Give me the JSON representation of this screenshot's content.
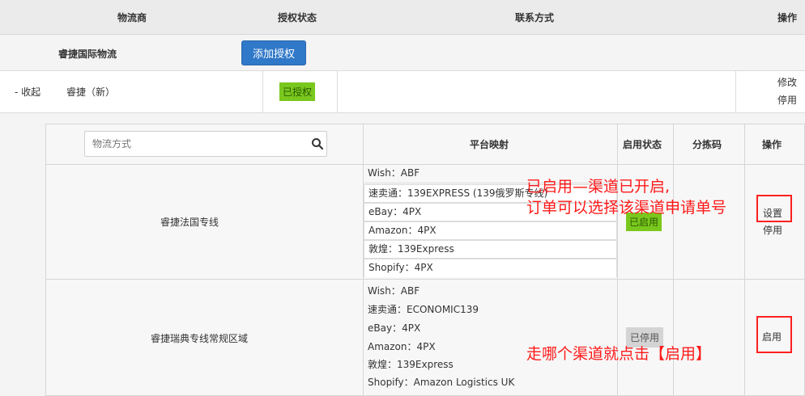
{
  "header": {
    "carrier": "物流商",
    "auth_status": "授权状态",
    "contact": "联系方式",
    "actions": "操作"
  },
  "provider": {
    "name": "睿捷国际物流",
    "add_auth_button": "添加授权"
  },
  "account": {
    "collapse": "- 收起",
    "name": "睿捷（新）",
    "status": "已授权",
    "action_edit": "修改",
    "action_disable": "停用"
  },
  "channels_table": {
    "search_placeholder": "物流方式",
    "columns": {
      "mapping": "平台映射",
      "status": "启用状态",
      "sort_code": "分拣码",
      "actions": "操作"
    },
    "rows": [
      {
        "name": "睿捷法国专线",
        "mappings": [
          "Wish：ABF",
          "速卖通：139EXPRESS (139俄罗斯专线)",
          "eBay：4PX",
          "Amazon：4PX",
          "敦煌：139Express",
          "Shopify：4PX"
        ],
        "status": "已启用",
        "action_primary": "设置",
        "action_secondary": "停用"
      },
      {
        "name": "睿捷瑞典专线常规区域",
        "mappings": [
          "Wish：ABF",
          "速卖通：ECONOMIC139",
          "eBay：4PX",
          "Amazon：4PX",
          "敦煌：139Express",
          "Shopify：Amazon Logistics UK"
        ],
        "status": "已停用",
        "action_primary": "启用"
      }
    ]
  },
  "annotations": {
    "enabled_line1": "已启用—渠道已开启,",
    "enabled_line2": "订单可以选择该渠道申请单号",
    "click_enable": "走哪个渠道就点击【启用】"
  },
  "colors": {
    "link": "#2b72c0",
    "primary_button": "#3078c8",
    "enabled_badge": "#7ac81e",
    "disabled_badge": "#d4d4d4",
    "annotation": "#ff1a1a"
  }
}
